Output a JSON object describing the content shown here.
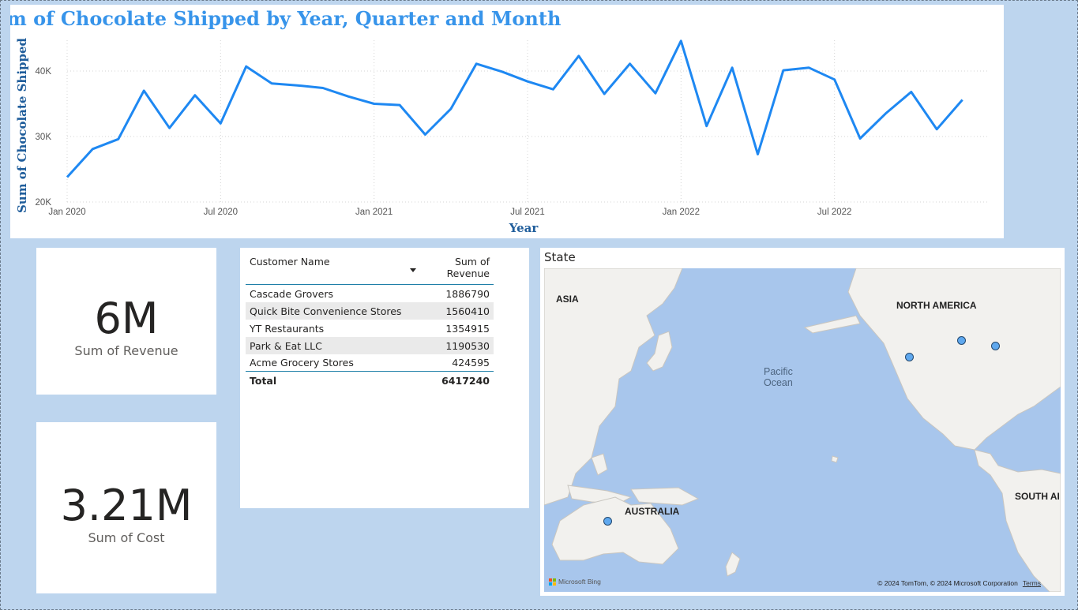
{
  "line_chart": {
    "title": "Sum of Chocolate Shipped by Year, Quarter and Month",
    "line_color": "#1e88f2",
    "chart_data": {
      "type": "line",
      "title": "Sum of Chocolate Shipped by Year, Quarter and Month",
      "xlabel": "Year",
      "ylabel": "Sum of Chocolate Shipped",
      "x": [
        "2020-01",
        "2020-02",
        "2020-03",
        "2020-04",
        "2020-05",
        "2020-06",
        "2020-07",
        "2020-08",
        "2020-09",
        "2020-10",
        "2020-11",
        "2020-12",
        "2021-01",
        "2021-02",
        "2021-03",
        "2021-04",
        "2021-05",
        "2021-06",
        "2021-07",
        "2021-08",
        "2021-09",
        "2021-10",
        "2021-11",
        "2021-12",
        "2022-01",
        "2022-02",
        "2022-03",
        "2022-04",
        "2022-05",
        "2022-06",
        "2022-07",
        "2022-08",
        "2022-09",
        "2022-10",
        "2022-11",
        "2022-12",
        "2023-01"
      ],
      "series": [
        {
          "values": [
            23800,
            28100,
            29600,
            37000,
            31300,
            36300,
            32000,
            40700,
            38100,
            37800,
            37400,
            36100,
            35000,
            34800,
            30300,
            34200,
            41100,
            39900,
            38400,
            37200,
            42300,
            36500,
            41100,
            36600,
            44600,
            31600,
            40500,
            27300,
            40100,
            40500,
            38700,
            29700,
            33500,
            36800,
            31100,
            35600,
            null
          ]
        }
      ],
      "x_ticks": [
        "Jan 2020",
        "Jul 2020",
        "Jan 2021",
        "Jul 2021",
        "Jan 2022",
        "Jul 2022"
      ],
      "y_ticks": [
        "20K",
        "30K",
        "40K"
      ],
      "ylim": [
        20000,
        46500
      ],
      "grid": true
    }
  },
  "cards": {
    "revenue": {
      "value": "6M",
      "label": "Sum of Revenue"
    },
    "cost": {
      "value": "3.21M",
      "label": "Sum of Cost"
    }
  },
  "table": {
    "headers": [
      "Customer Name",
      "Sum of Revenue"
    ],
    "rows": [
      {
        "name": "Cascade Grovers",
        "revenue": "1886790"
      },
      {
        "name": "Quick Bite Convenience Stores",
        "revenue": "1560410"
      },
      {
        "name": "YT Restaurants",
        "revenue": "1354915"
      },
      {
        "name": "Park & Eat LLC",
        "revenue": "1190530"
      },
      {
        "name": "Acme Grocery Stores",
        "revenue": "424595"
      }
    ],
    "total_label": "Total",
    "total_value": "6417240"
  },
  "map": {
    "title": "State",
    "labels": {
      "asia": "ASIA",
      "north_america": "NORTH AMERICA",
      "australia": "AUSTRALIA",
      "south_america": "SOUTH AI",
      "ocean_line1": "Pacific",
      "ocean_line2": "Ocean"
    },
    "provider": "Microsoft Bing",
    "copyright": "© 2024 TomTom, © 2024 Microsoft Corporation",
    "terms": "Terms",
    "dot_color": "#5fa8ee"
  }
}
